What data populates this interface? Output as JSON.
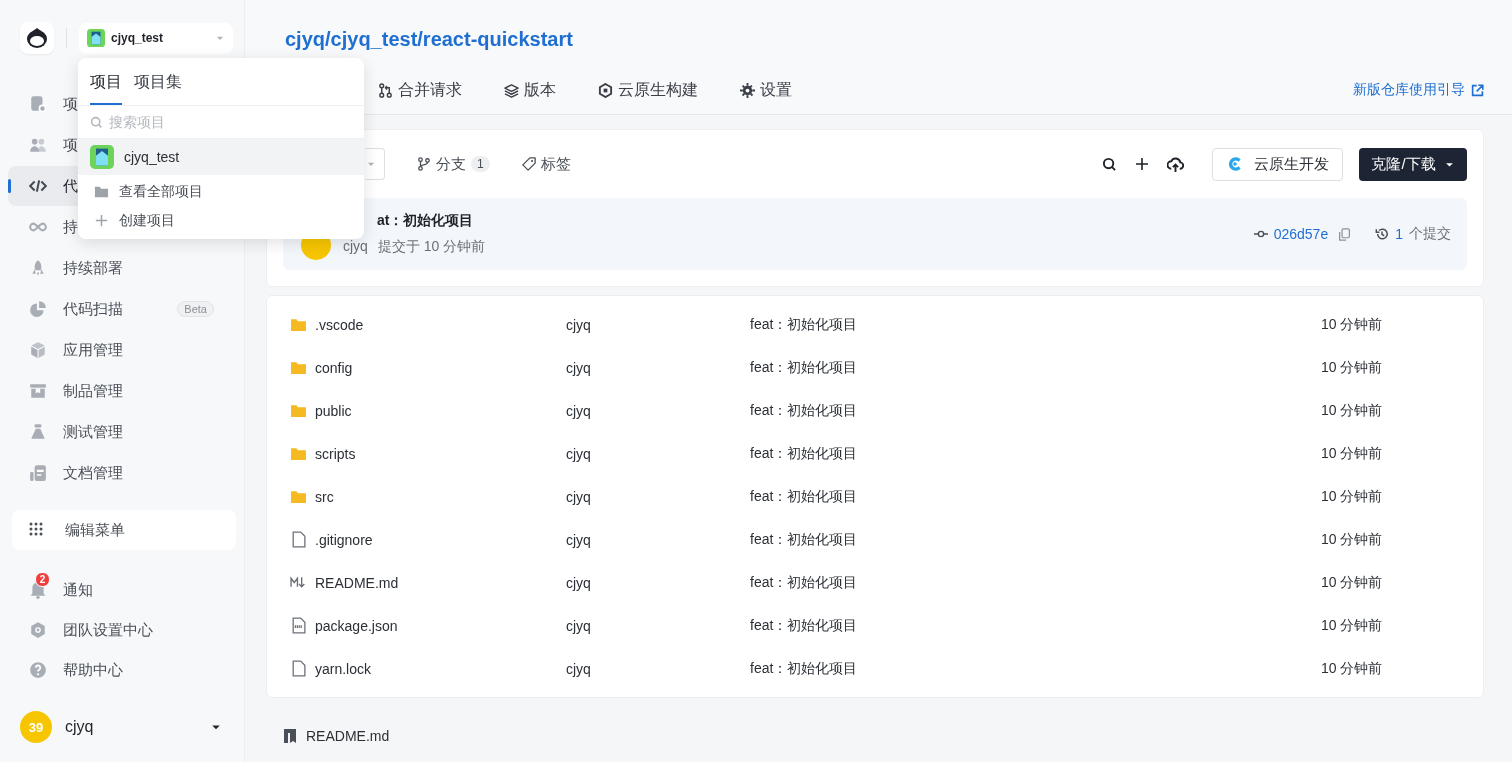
{
  "sidebar": {
    "project_selector": {
      "label": "cjyq_test"
    },
    "items": [
      {
        "label": "项",
        "selected": false
      },
      {
        "label": "项",
        "selected": false
      },
      {
        "label": "代",
        "selected": true
      },
      {
        "label": "持",
        "selected": false
      },
      {
        "label": "持续部署",
        "selected": false
      },
      {
        "label": "代码扫描",
        "selected": false,
        "badge": "Beta"
      },
      {
        "label": "应用管理",
        "selected": false
      },
      {
        "label": "制品管理",
        "selected": false
      },
      {
        "label": "测试管理",
        "selected": false
      },
      {
        "label": "文档管理",
        "selected": false
      }
    ],
    "edit_menu": "编辑菜单",
    "footer_items": [
      {
        "label": "通知",
        "badge": "2"
      },
      {
        "label": "团队设置中心"
      },
      {
        "label": "帮助中心"
      }
    ],
    "user": {
      "avatar": "39",
      "name": "cjyq"
    }
  },
  "project_menu": {
    "tabs": [
      {
        "label": "项目",
        "selected": true
      },
      {
        "label": "项目集",
        "selected": false
      }
    ],
    "search": {
      "placeholder": "搜索项目"
    },
    "projects": [
      {
        "name": "cjyq_test",
        "selected": true
      }
    ],
    "actions": [
      {
        "label": "查看全部项目"
      },
      {
        "label": "创建项目"
      }
    ]
  },
  "repo": {
    "path": "cjyq/cjyq_test/react-quickstart",
    "tabs": [
      {
        "label": "合并请求"
      },
      {
        "label": "版本"
      },
      {
        "label": "云原生构建"
      },
      {
        "label": "设置"
      }
    ],
    "guide_link": "新版仓库使用引导",
    "toolbar": {
      "branches": "分支",
      "branch_count": "1",
      "tags": "标签",
      "cloud_dev": "云原生开发",
      "clone": "克隆/下载"
    },
    "commit": {
      "message": "at：初始化项目",
      "author": "cjyq",
      "time": "提交于 10 分钟前",
      "hash": "026d57e",
      "count": "1",
      "count_label": "个提交"
    },
    "files": [
      {
        "name": ".vscode",
        "kind": "folder",
        "author": "cjyq",
        "message": "feat：初始化项目",
        "time": "10 分钟前"
      },
      {
        "name": "config",
        "kind": "folder",
        "author": "cjyq",
        "message": "feat：初始化项目",
        "time": "10 分钟前"
      },
      {
        "name": "public",
        "kind": "folder",
        "author": "cjyq",
        "message": "feat：初始化项目",
        "time": "10 分钟前"
      },
      {
        "name": "scripts",
        "kind": "folder",
        "author": "cjyq",
        "message": "feat：初始化项目",
        "time": "10 分钟前"
      },
      {
        "name": "src",
        "kind": "folder",
        "author": "cjyq",
        "message": "feat：初始化项目",
        "time": "10 分钟前"
      },
      {
        "name": ".gitignore",
        "kind": "file",
        "author": "cjyq",
        "message": "feat：初始化项目",
        "time": "10 分钟前"
      },
      {
        "name": "README.md",
        "kind": "markdown",
        "author": "cjyq",
        "message": "feat：初始化项目",
        "time": "10 分钟前"
      },
      {
        "name": "package.json",
        "kind": "json",
        "author": "cjyq",
        "message": "feat：初始化项目",
        "time": "10 分钟前"
      },
      {
        "name": "yarn.lock",
        "kind": "file",
        "author": "cjyq",
        "message": "feat：初始化项目",
        "time": "10 分钟前"
      }
    ],
    "readme": "README.md"
  }
}
